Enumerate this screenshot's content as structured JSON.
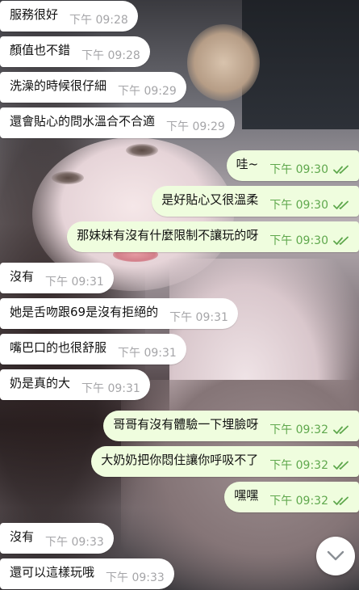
{
  "messages": [
    {
      "direction": "in",
      "text": "服務很好",
      "time": "下午 09:28"
    },
    {
      "direction": "in",
      "text": "顏值也不錯",
      "time": "下午 09:28"
    },
    {
      "direction": "in",
      "text": "洗澡的時候很仔細",
      "time": "下午 09:29"
    },
    {
      "direction": "in",
      "text": "還會貼心的問水溫合不合適",
      "time": "下午 09:29"
    },
    {
      "direction": "out",
      "text": "哇~",
      "time": "下午 09:30",
      "status": "read"
    },
    {
      "direction": "out",
      "text": "是好貼心又很溫柔",
      "time": "下午 09:30",
      "status": "read"
    },
    {
      "direction": "out",
      "text": "那妹妹有沒有什麼限制不讓玩的呀",
      "time": "下午 09:30",
      "status": "read"
    },
    {
      "direction": "in",
      "text": "沒有",
      "time": "下午 09:31"
    },
    {
      "direction": "in",
      "text": "她是舌吻跟69是沒有拒絕的",
      "time": "下午 09:31"
    },
    {
      "direction": "in",
      "text": "嘴巴口的也很舒服",
      "time": "下午 09:31"
    },
    {
      "direction": "in",
      "text": "奶是真的大",
      "time": "下午 09:31"
    },
    {
      "direction": "out",
      "text": "哥哥有沒有體驗一下埋臉呀",
      "time": "下午 09:32",
      "status": "read"
    },
    {
      "direction": "out",
      "text": "大奶奶把你悶住讓你呼吸不了",
      "time": "下午 09:32",
      "status": "read"
    },
    {
      "direction": "out",
      "text": "嘿嘿",
      "time": "下午 09:32",
      "status": "read"
    },
    {
      "direction": "in",
      "text": "沒有",
      "time": "下午 09:33"
    },
    {
      "direction": "in",
      "text": "還可以這樣玩哦",
      "time": "下午 09:33"
    }
  ],
  "scroll_button": {
    "icon": "chevron-down-icon"
  },
  "colors": {
    "incoming_bubble": "#ffffff",
    "outgoing_bubble": "#effdde",
    "incoming_time": "#a5a5a8",
    "outgoing_time": "#5fa84d"
  }
}
